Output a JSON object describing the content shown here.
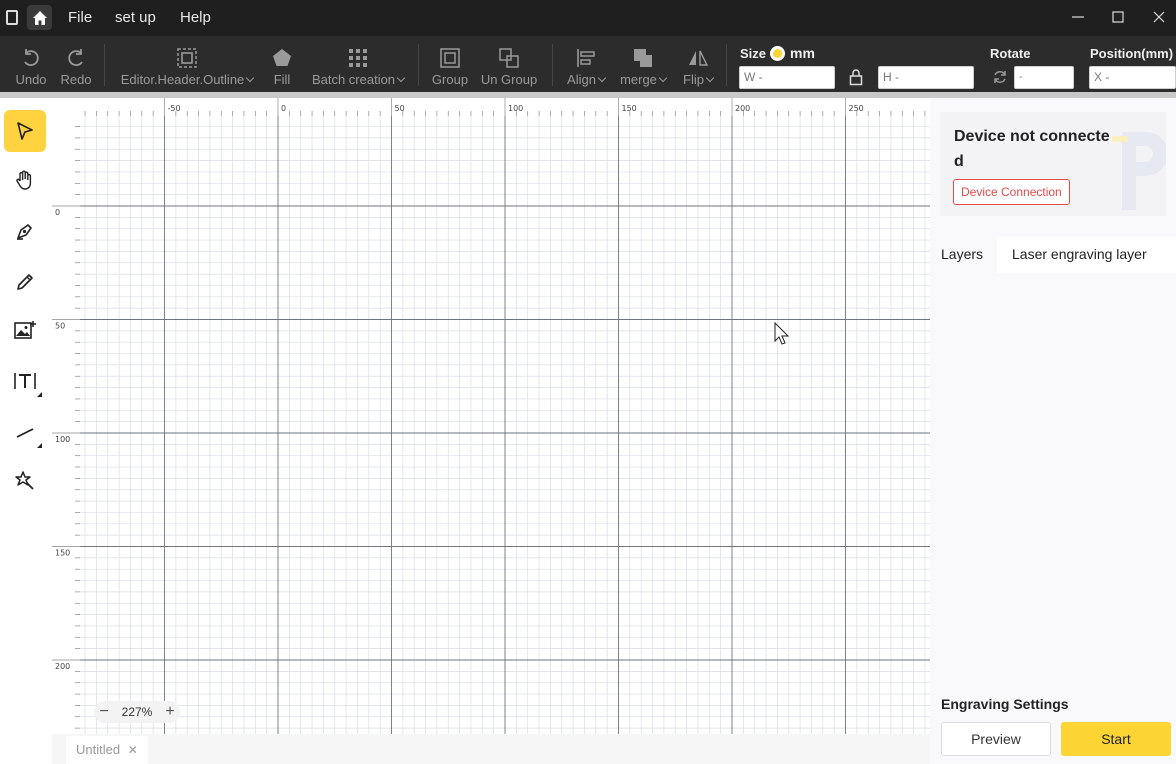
{
  "menu": {
    "file": "File",
    "setup": "set up",
    "help": "Help"
  },
  "toolbar": {
    "undo": "Undo",
    "redo": "Redo",
    "outline": "Editor.Header.Outline",
    "fill": "Fill",
    "batch": "Batch creation",
    "group": "Group",
    "ungroup": "Un Group",
    "align": "Align",
    "merge": "merge",
    "flip": "Flip",
    "size_label": "Size",
    "unit": "mm",
    "w_placeholder": "W -",
    "h_placeholder": "H -",
    "rotate_label": "Rotate",
    "rotate_value": "-",
    "position_label": "Position(mm)",
    "x_placeholder": "X -"
  },
  "left_tools": [
    "select",
    "hand",
    "pen",
    "pencil",
    "image",
    "text",
    "line",
    "magic"
  ],
  "canvas": {
    "ruler_x_labels": [
      "-50",
      "0",
      "50",
      "100",
      "150",
      "200",
      "250"
    ],
    "ruler_y_labels": [
      "0",
      "50",
      "100",
      "150",
      "200"
    ],
    "zoom": "227%"
  },
  "tabs": {
    "document": "Untitled"
  },
  "right_panel": {
    "device_status": "Device not connected",
    "device_button": "Device Connection",
    "tab_layers": "Layers",
    "tab_laser": "Laser engraving layer",
    "engraving_title": "Engraving Settings",
    "preview": "Preview",
    "start": "Start"
  },
  "colors": {
    "accent": "#fcd535",
    "danger": "#e24a4a",
    "toolbar_bg": "#2c2c2c",
    "titlebar_bg": "#1f1f1f"
  }
}
